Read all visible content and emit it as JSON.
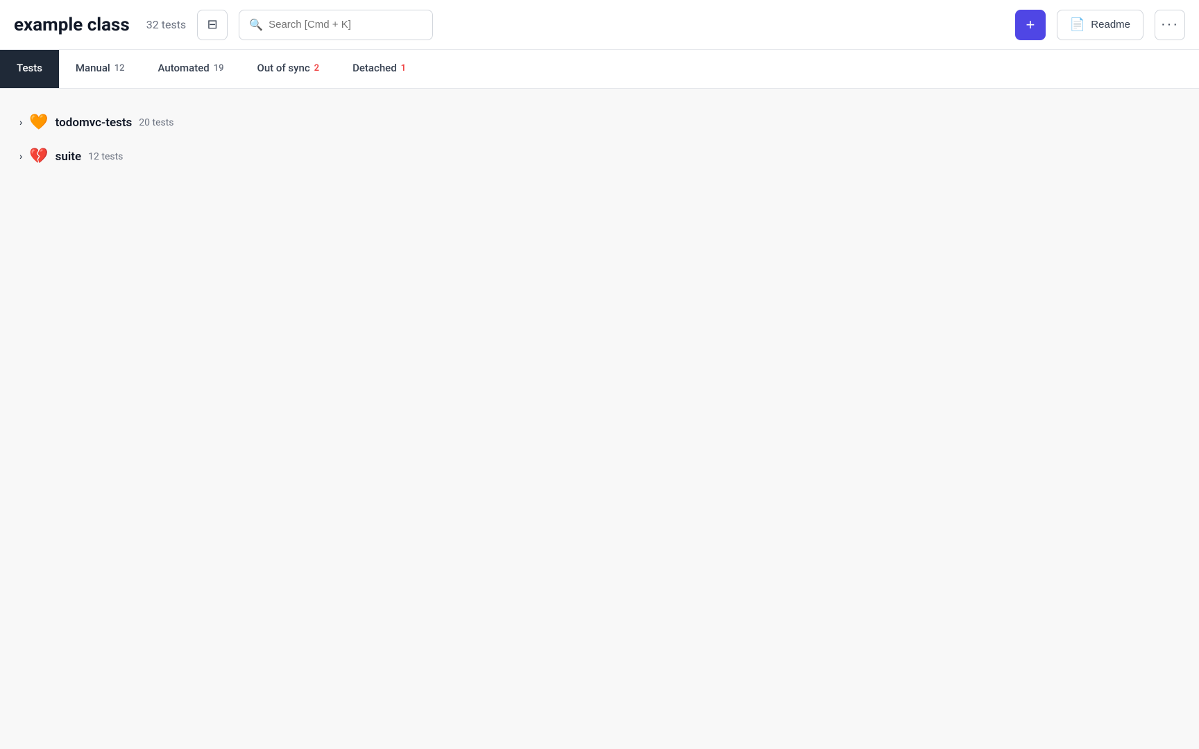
{
  "header": {
    "title": "example class",
    "test_count": "32 tests",
    "search_placeholder": "Search [Cmd + K]",
    "add_label": "+",
    "readme_label": "Readme",
    "more_label": "···"
  },
  "tabs": [
    {
      "id": "tests",
      "label": "Tests",
      "count": "",
      "active": true
    },
    {
      "id": "manual",
      "label": "Manual",
      "count": "12",
      "active": false
    },
    {
      "id": "automated",
      "label": "Automated",
      "count": "19",
      "active": false
    },
    {
      "id": "out-of-sync",
      "label": "Out of sync",
      "count": "2",
      "count_red": true,
      "active": false
    },
    {
      "id": "detached",
      "label": "Detached",
      "count": "1",
      "count_red": true,
      "active": false
    }
  ],
  "suites": [
    {
      "name": "todomvc-tests",
      "emoji": "🧡",
      "test_count": "20 tests"
    },
    {
      "name": "suite",
      "emoji": "💔",
      "test_count": "12 tests"
    }
  ]
}
